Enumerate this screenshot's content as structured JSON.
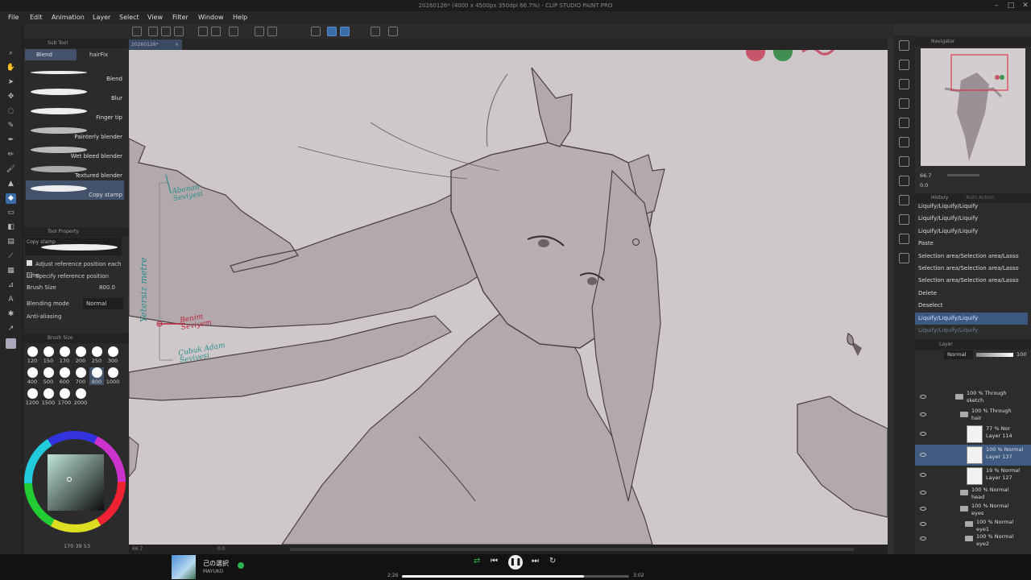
{
  "window": {
    "title": "20260126* (4000 x 4500px 350dpi 66.7%) - CLIP STUDIO PAINT PRO"
  },
  "menu": [
    "File",
    "Edit",
    "Animation",
    "Layer",
    "Select",
    "View",
    "Filter",
    "Window",
    "Help"
  ],
  "document_tab": "20260126*",
  "sub_tool": {
    "header": "Sub Tool",
    "tabs": [
      "Blend",
      "hairFix"
    ],
    "brushes": [
      "Blend",
      "Blur",
      "Finger tip",
      "Painterly blender",
      "Wet bleed blender",
      "Textured blender",
      "Copy stamp"
    ],
    "selected_brush": "Copy stamp"
  },
  "tool_property": {
    "header": "Tool Property",
    "brush_name": "Copy stamp",
    "options": [
      "Adjust reference position each time",
      "Specify reference position"
    ],
    "brush_size_label": "Brush Size",
    "brush_size_value": "800.0",
    "blending_mode_label": "Blending mode",
    "blending_mode_value": "Normal",
    "anti_aliasing_label": "Anti-aliasing"
  },
  "brush_size_panel": {
    "header": "Brush Size",
    "sizes": [
      "120",
      "150",
      "170",
      "200",
      "250",
      "300",
      "400",
      "500",
      "600",
      "700",
      "800",
      "1000",
      "1200",
      "1500",
      "1700",
      "2000"
    ],
    "selected": "800"
  },
  "color_readout": "170 39 53",
  "annotations": {
    "vertical": "Yetersiz metre",
    "top": "Abonan Seviyesi",
    "middle": "Benim Seviyem",
    "bottom": "Çubuk Adam Seviyesi"
  },
  "navigator": {
    "header": "Navigator",
    "zoom": "66.7",
    "rotation": "0.0"
  },
  "history": {
    "header": "History",
    "tab2": "Auto Action",
    "items": [
      "Liquify/Liquify/Liquify",
      "Liquify/Liquify/Liquify",
      "Liquify/Liquify/Liquify",
      "Paste",
      "Selection area/Selection area/Lasso",
      "Selection area/Selection area/Lasso",
      "Selection area/Selection area/Lasso",
      "Delete",
      "Deselect",
      "Liquify/Liquify/Liquify",
      "Liquify/Liquify/Liquify"
    ],
    "selected_index": 9
  },
  "layer_panel": {
    "header": "Layer",
    "blend_mode": "Normal",
    "opacity": "100",
    "layers": [
      {
        "mode": "100 % Through",
        "name": "sketch"
      },
      {
        "mode": "100 % Through",
        "name": "hair"
      },
      {
        "mode": "77 % Nor",
        "name": "Layer 114"
      },
      {
        "mode": "100 % Normal",
        "name": "Layer 137"
      },
      {
        "mode": "19 % Normal",
        "name": "Layer 127"
      },
      {
        "mode": "100 % Normal",
        "name": "head"
      },
      {
        "mode": "100 % Normal",
        "name": "eyes"
      },
      {
        "mode": "100 % Normal",
        "name": "eye1"
      },
      {
        "mode": "100 % Normal",
        "name": "eye2"
      }
    ],
    "selected_index": 3
  },
  "statusbar": {
    "zoom": "66.7",
    "angle": "0.0"
  },
  "media": {
    "title": "己の選択",
    "artist": "MAYUKO",
    "elapsed": "2:26",
    "total": "3:02",
    "progress": 0.802
  },
  "colors": {
    "accent": "#3c6dab",
    "canvas": "#cfc8ca",
    "annotation_teal": "#2a8f8a",
    "annotation_red": "#b8233a"
  }
}
